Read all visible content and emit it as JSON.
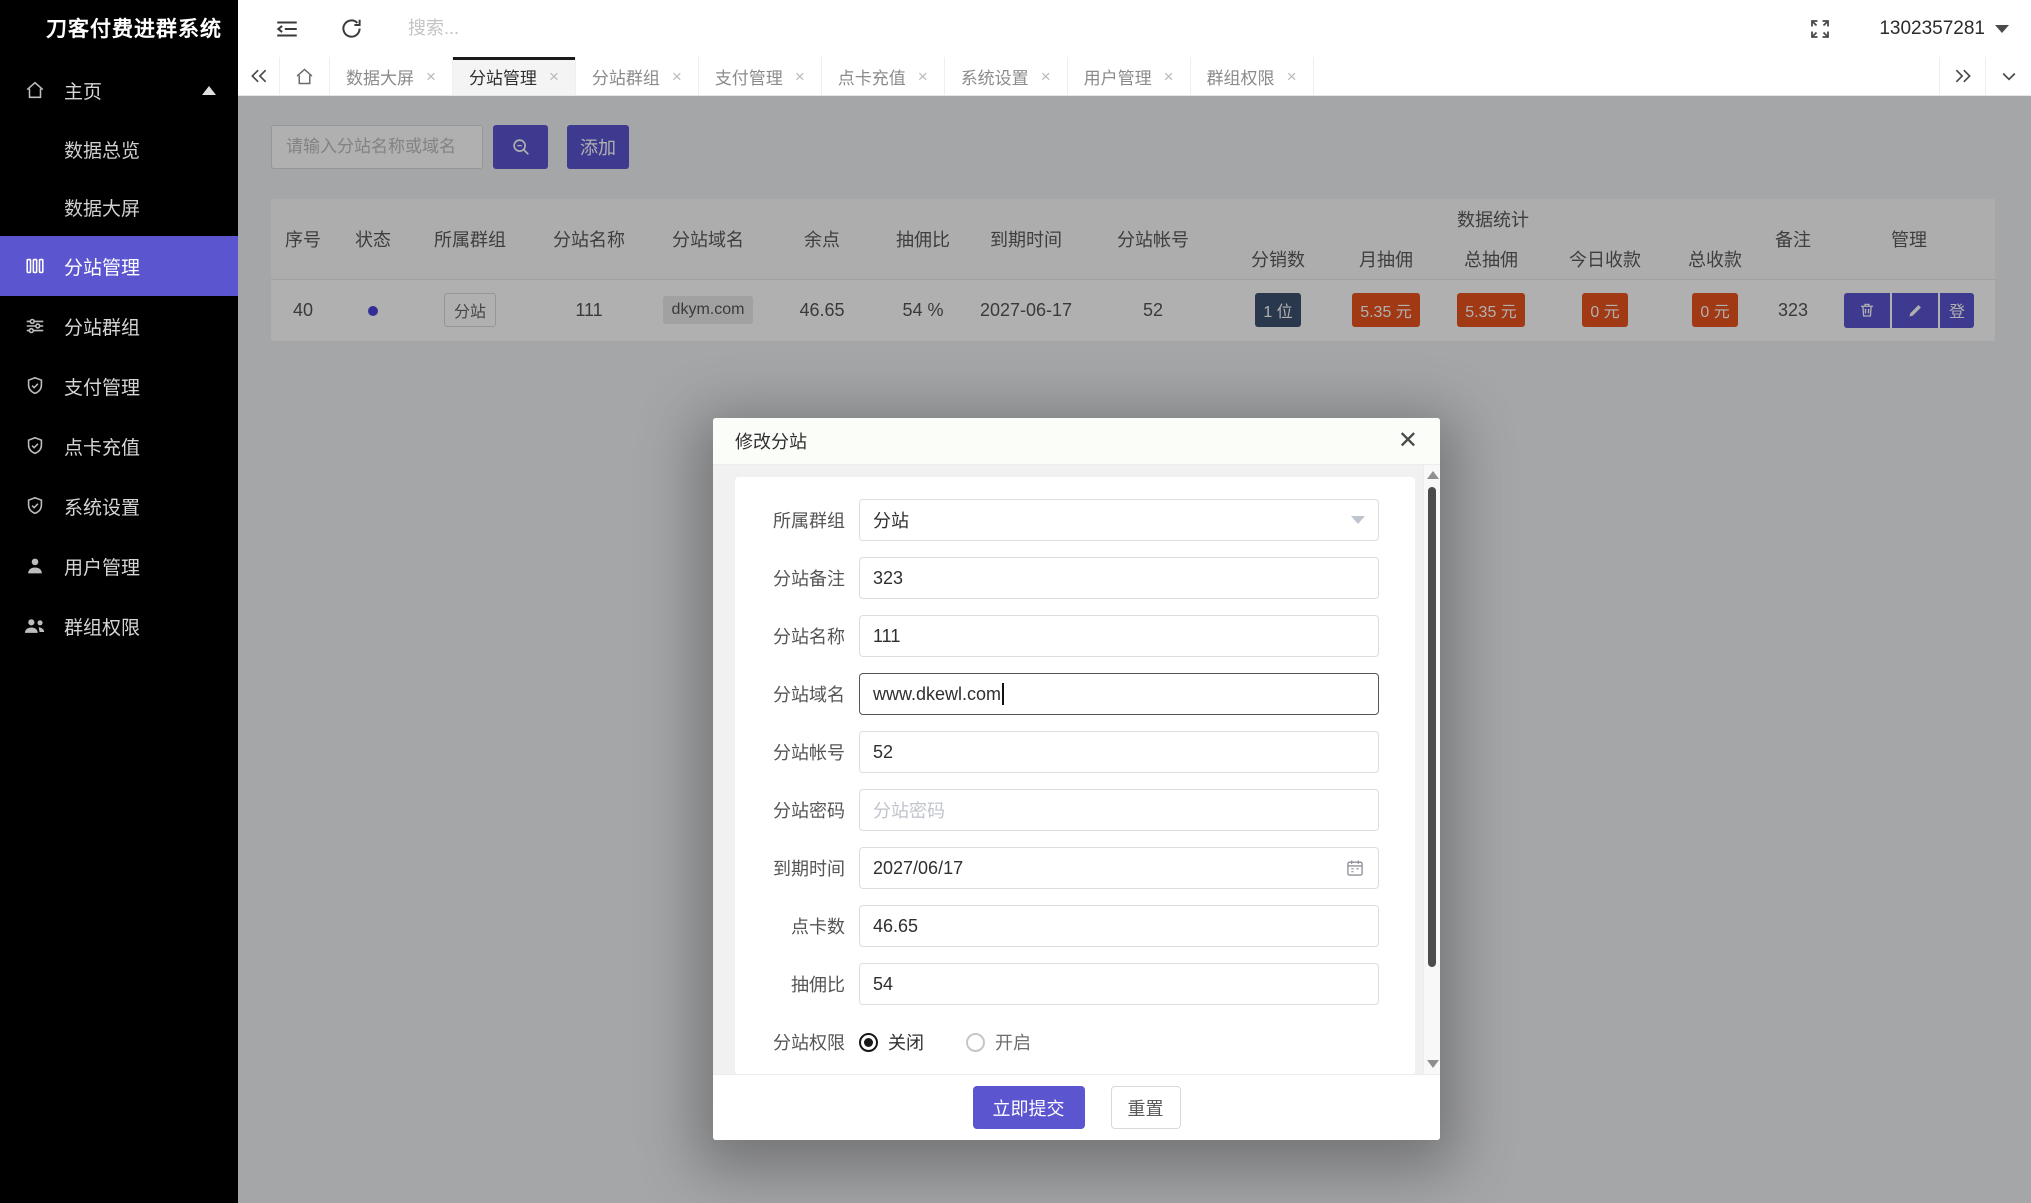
{
  "colors": {
    "accent": "#5b55cf",
    "badge_orange": "#e8531d",
    "badge_navy": "#3d5270",
    "sidebar_bg": "#000000",
    "status_dot": "#4a43d8"
  },
  "app": {
    "brand": "刀客付费进群系统",
    "user_id": "1302357281"
  },
  "topbar": {
    "search_placeholder": "搜索..."
  },
  "sidebar": {
    "home": {
      "label": "主页"
    },
    "sub": [
      {
        "label": "数据总览"
      },
      {
        "label": "数据大屏"
      }
    ],
    "items": [
      {
        "label": "分站管理"
      },
      {
        "label": "分站群组"
      },
      {
        "label": "支付管理"
      },
      {
        "label": "点卡充值"
      },
      {
        "label": "系统设置"
      },
      {
        "label": "用户管理"
      },
      {
        "label": "群组权限"
      }
    ]
  },
  "tabs": {
    "close_glyph": "×",
    "items": [
      {
        "label": "数据大屏"
      },
      {
        "label": "分站管理"
      },
      {
        "label": "分站群组"
      },
      {
        "label": "支付管理"
      },
      {
        "label": "点卡充值"
      },
      {
        "label": "系统设置"
      },
      {
        "label": "用户管理"
      },
      {
        "label": "群组权限"
      }
    ]
  },
  "toolbar": {
    "search_placeholder": "请输入分站名称或域名",
    "add_label": "添加"
  },
  "table": {
    "columns_left": [
      "序号",
      "状态",
      "所属群组",
      "分站名称",
      "分站域名",
      "余点",
      "抽佣比",
      "到期时间",
      "分站帐号"
    ],
    "group": {
      "title": "数据统计",
      "children": [
        "分销数",
        "月抽佣",
        "总抽佣",
        "今日收款",
        "总收款"
      ]
    },
    "columns_right": [
      "备注",
      "管理"
    ],
    "row": {
      "index": "40",
      "group_tag": "分站",
      "name": "111",
      "domain": "dkym.com",
      "balance": "46.65",
      "commission_rate": "54 %",
      "expire_date": "2027-06-17",
      "account": "52",
      "distributors": "1 位",
      "month_commission": "5.35 元",
      "total_commission": "5.35 元",
      "today_income": "0 元",
      "total_income": "0 元",
      "remark": "323",
      "login_label": "登"
    }
  },
  "modal": {
    "title": "修改分站",
    "fields": {
      "group": {
        "label": "所属群组",
        "value": "分站"
      },
      "remark": {
        "label": "分站备注",
        "value": "323"
      },
      "name": {
        "label": "分站名称",
        "value": "111"
      },
      "domain": {
        "label": "分站域名",
        "value": "www.dkewl.com"
      },
      "account": {
        "label": "分站帐号",
        "value": "52"
      },
      "password": {
        "label": "分站密码",
        "placeholder": "分站密码"
      },
      "expire": {
        "label": "到期时间",
        "value": "2027/06/17"
      },
      "points": {
        "label": "点卡数",
        "value": "46.65"
      },
      "rate": {
        "label": "抽佣比",
        "value": "54"
      },
      "permission": {
        "label": "分站权限",
        "off_label": "关闭",
        "on_label": "开启",
        "selected": "关闭"
      }
    },
    "submit_label": "立即提交",
    "reset_label": "重置"
  }
}
